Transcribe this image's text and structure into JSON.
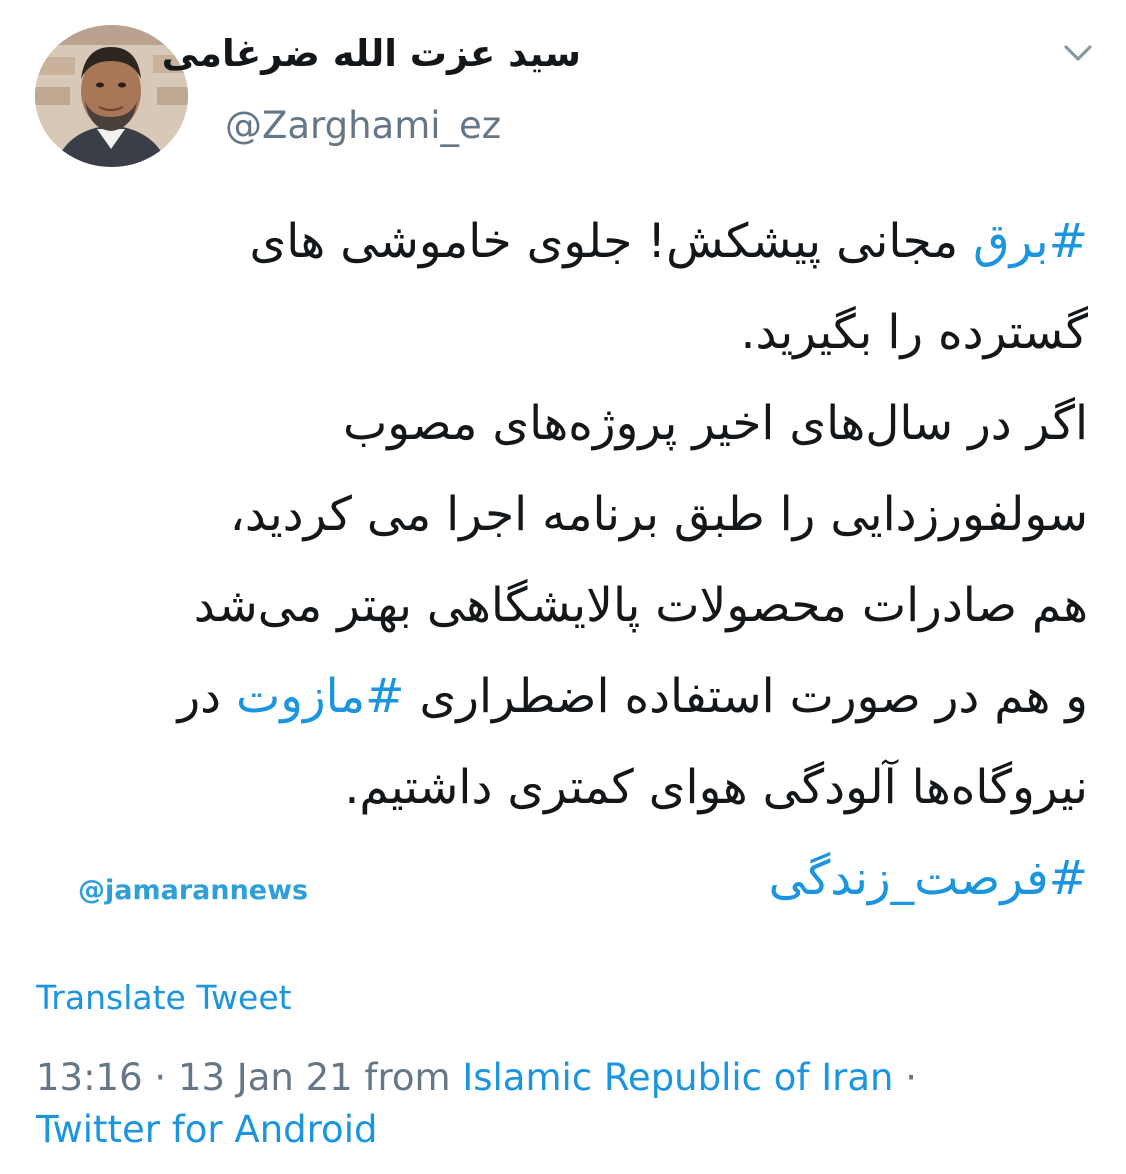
{
  "tweet": {
    "author": {
      "display_name": "سید عزت الله ضرغامی",
      "handle": "@Zarghami_ez"
    },
    "menu_icon": "chevron-down-icon",
    "body": {
      "line1": {
        "hashtag": "#برق",
        "text": " مجانی پیشکش! جلوی خاموشی های"
      },
      "line2": "گسترده را بگیرید.",
      "line3": "اگر در سال‌های اخیر پروژه‌های مصوب",
      "line4": "سولفورزدایی را طبق برنامه اجرا می کردید،",
      "line5": "هم صادرات محصولات پالایشگاهی بهتر می‌شد",
      "line6": {
        "before": "و هم در صورت استفاده اضطراری ",
        "hashtag": "#مازوت",
        "after": " در"
      },
      "line7": "نیروگاه‌ها آلودگی هوای کمتری داشتیم.",
      "line8_hashtag": "#فرصت_زندگی"
    },
    "watermark": "@jamarannews",
    "translate_label": "Translate Tweet",
    "meta": {
      "time": "13:16",
      "separator": " · ",
      "date": "13 Jan 21",
      "from_label": " from ",
      "location": "Islamic Republic of Iran",
      "trailing_separator": " ·",
      "source": "Twitter for Android"
    },
    "colors": {
      "link": "#1b95e0",
      "text": "#14171a",
      "secondary": "#657786"
    }
  }
}
